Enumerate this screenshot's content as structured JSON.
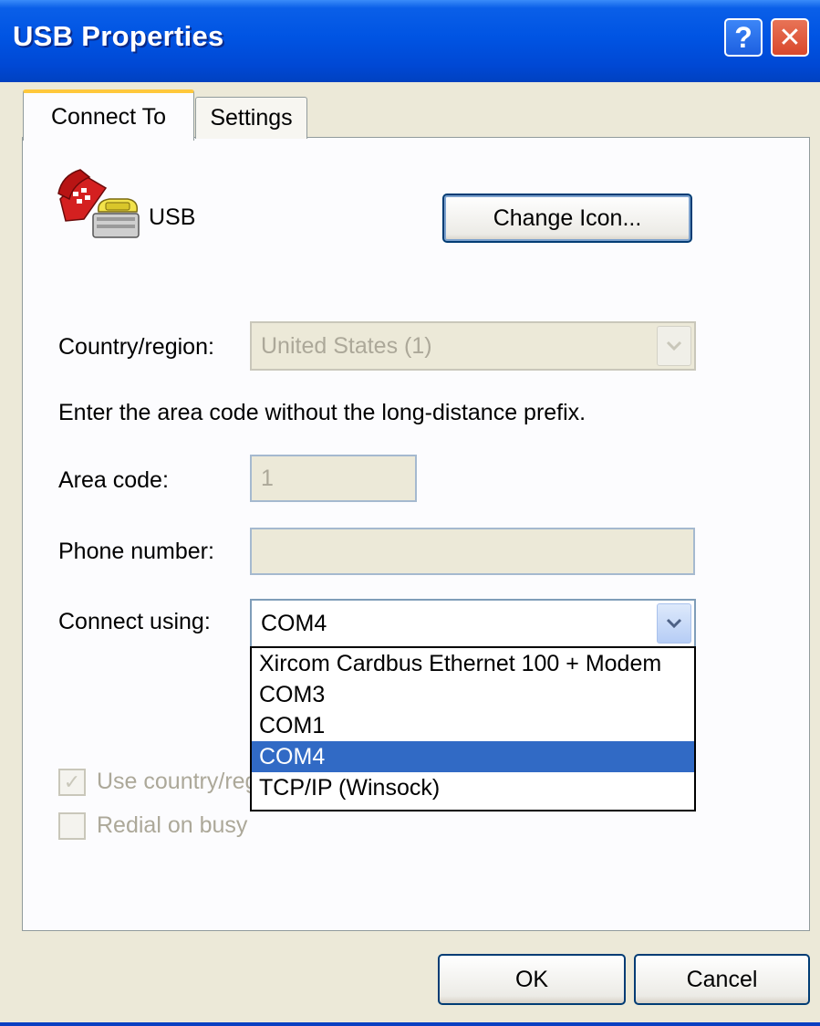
{
  "window": {
    "title": "USB Properties",
    "help_glyph": "?",
    "close_glyph": "✕"
  },
  "tabs": [
    {
      "label": "Connect To",
      "active": true
    },
    {
      "label": "Settings",
      "active": false
    }
  ],
  "connection": {
    "name": "USB",
    "icon": "phone-icon",
    "change_icon_label": "Change Icon..."
  },
  "country": {
    "label": "Country/region:",
    "value": "United States (1)",
    "enabled": false
  },
  "hint": "Enter the area code without the long-distance prefix.",
  "area_code": {
    "label": "Area code:",
    "value": "1",
    "enabled": false
  },
  "phone_number": {
    "label": "Phone number:",
    "value": "",
    "enabled": false
  },
  "connect_using": {
    "label": "Connect using:",
    "value": "COM4",
    "options": [
      "Xircom Cardbus Ethernet 100 + Modem",
      "COM3",
      "COM1",
      "COM4",
      "TCP/IP (Winsock)"
    ],
    "selected_index": 3
  },
  "checkboxes": {
    "use_country": {
      "label": "Use country/region code and area code",
      "checked": true,
      "enabled": false
    },
    "redial": {
      "label": "Redial on busy",
      "checked": false,
      "enabled": false
    }
  },
  "buttons": {
    "ok": "OK",
    "cancel": "Cancel"
  },
  "colors": {
    "titlebar": "#0054e3",
    "selection": "#316ac5",
    "disabled_text": "#aca899"
  }
}
